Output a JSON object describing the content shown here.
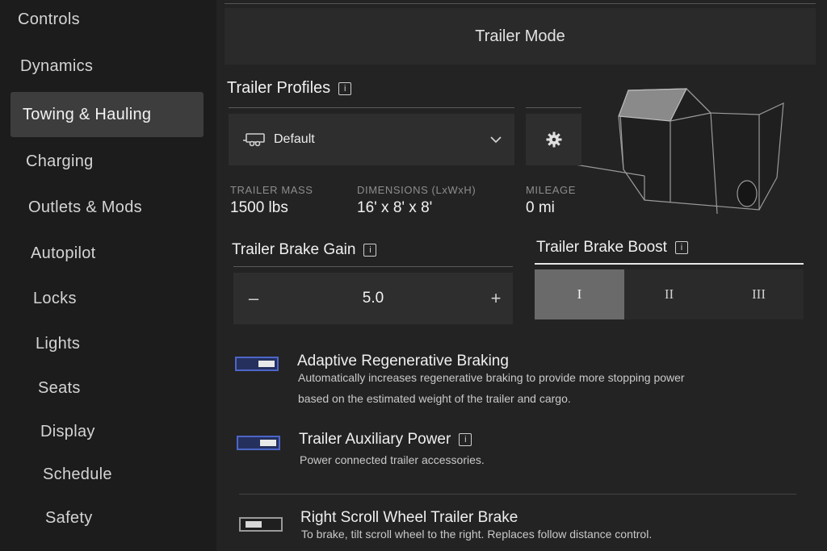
{
  "sidebar": {
    "items": [
      {
        "label": "Controls"
      },
      {
        "label": "Dynamics"
      },
      {
        "label": "Towing & Hauling"
      },
      {
        "label": "Charging"
      },
      {
        "label": "Outlets & Mods"
      },
      {
        "label": "Autopilot"
      },
      {
        "label": "Locks"
      },
      {
        "label": "Lights"
      },
      {
        "label": "Seats"
      },
      {
        "label": "Display"
      },
      {
        "label": "Schedule"
      },
      {
        "label": "Safety"
      }
    ],
    "active": "Towing & Hauling"
  },
  "header": {
    "title": "Trailer Mode"
  },
  "profiles": {
    "title": "Trailer Profiles",
    "selected": "Default",
    "stats": [
      {
        "label": "TRAILER MASS",
        "value": "1500 lbs"
      },
      {
        "label": "DIMENSIONS (LxWxH)",
        "value": "16' x 8' x 8'"
      },
      {
        "label": "MILEAGE",
        "value": "0 mi"
      }
    ]
  },
  "brake_gain": {
    "title": "Trailer Brake Gain",
    "value": "5.0",
    "minus": "–",
    "plus": "+"
  },
  "brake_boost": {
    "title": "Trailer Brake Boost",
    "options": [
      "I",
      "II",
      "III"
    ],
    "selected": "I"
  },
  "options": [
    {
      "title": "Adaptive Regenerative Braking",
      "desc1": "Automatically increases regenerative braking to provide more stopping power",
      "desc2": "based on the estimated weight of the trailer and cargo.",
      "enabled": true
    },
    {
      "title": "Trailer Auxiliary Power",
      "desc1": "Power connected trailer accessories.",
      "enabled": true
    },
    {
      "title": "Right Scroll Wheel Trailer Brake",
      "desc1": "To brake, tilt scroll wheel to the right. Replaces follow distance control.",
      "enabled": false
    }
  ],
  "colors": {
    "toggle_on": "#4d66c8",
    "selected_segment": "#6a6a6b"
  }
}
